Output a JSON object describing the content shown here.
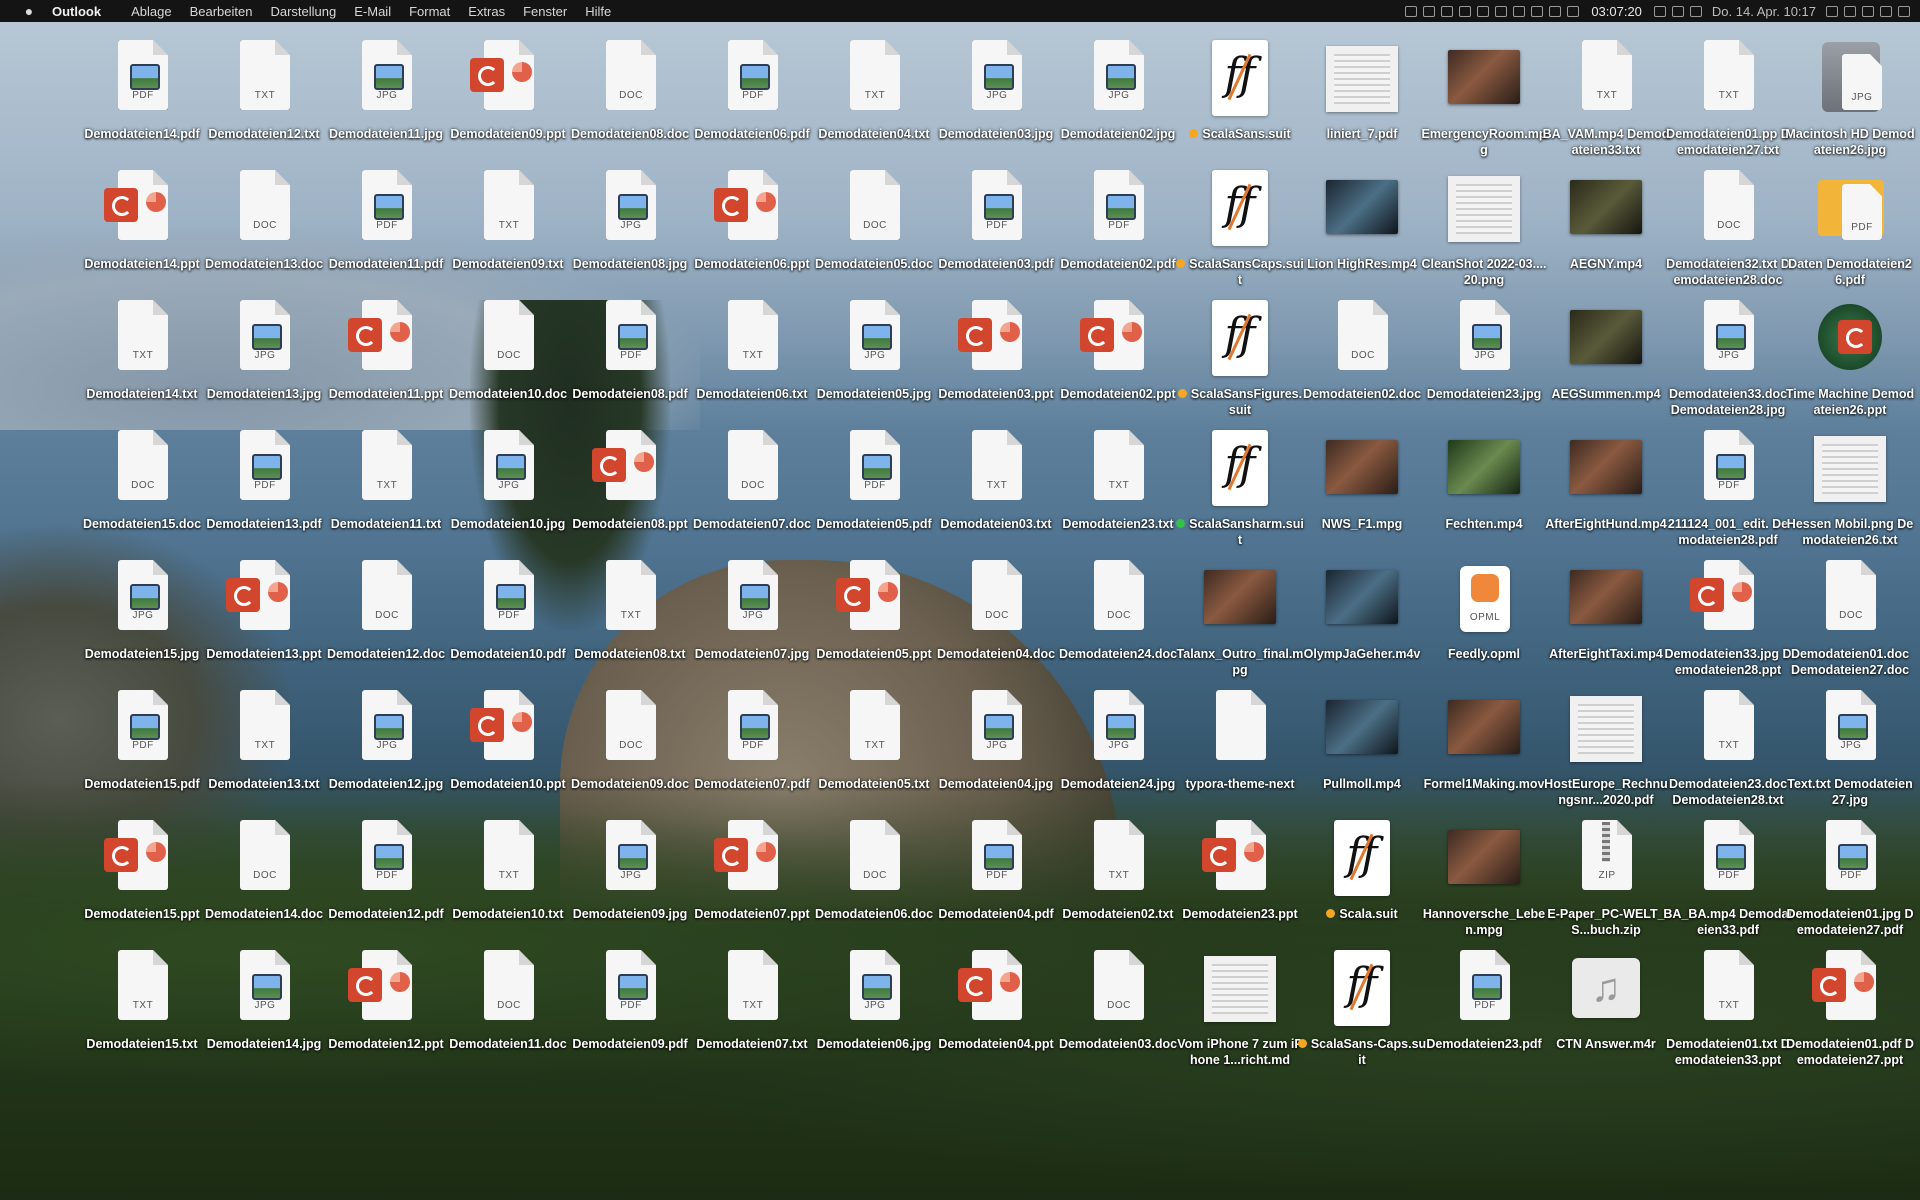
{
  "menubar": {
    "app": "Outlook",
    "menus": [
      "Ablage",
      "Bearbeiten",
      "Darstellung",
      "E-Mail",
      "Format",
      "Extras",
      "Fenster",
      "Hilfe"
    ],
    "timer": "03:07:20",
    "datetime": "Do. 14. Apr.  10:17"
  },
  "icons": [
    {
      "label": "Demodateien14.pdf",
      "kind": "pdf"
    },
    {
      "label": "Demodateien12.txt",
      "kind": "txt"
    },
    {
      "label": "Demodateien11.jpg",
      "kind": "jpg"
    },
    {
      "label": "Demodateien09.ppt",
      "kind": "ppt"
    },
    {
      "label": "Demodateien08.doc",
      "kind": "doc"
    },
    {
      "label": "Demodateien06.pdf",
      "kind": "pdf"
    },
    {
      "label": "Demodateien04.txt",
      "kind": "txt"
    },
    {
      "label": "Demodateien03.jpg",
      "kind": "jpg"
    },
    {
      "label": "Demodateien02.jpg",
      "kind": "jpg"
    },
    {
      "label": "ScalaSans.suit",
      "kind": "font",
      "tag": "orange"
    },
    {
      "label": "liniert_7.pdf",
      "kind": "img"
    },
    {
      "label": "EmergencyRoom.mpg",
      "kind": "video"
    },
    {
      "label": "BA_VAM.mp4 Demodateien33.txt",
      "kind": "txt"
    },
    {
      "label": "Demodateien01.pp Demodateien27.txt",
      "kind": "txt"
    },
    {
      "label": "Macintosh HD Demodateien26.jpg",
      "kind": "hd"
    },
    {
      "label": "Demodateien14.ppt",
      "kind": "ppt"
    },
    {
      "label": "Demodateien13.doc",
      "kind": "doc"
    },
    {
      "label": "Demodateien11.pdf",
      "kind": "pdf"
    },
    {
      "label": "Demodateien09.txt",
      "kind": "txt"
    },
    {
      "label": "Demodateien08.jpg",
      "kind": "jpg"
    },
    {
      "label": "Demodateien06.ppt",
      "kind": "ppt"
    },
    {
      "label": "Demodateien05.doc",
      "kind": "doc"
    },
    {
      "label": "Demodateien03.pdf",
      "kind": "pdf"
    },
    {
      "label": "Demodateien02.pdf",
      "kind": "pdf"
    },
    {
      "label": "ScalaSansCaps.suit",
      "kind": "font",
      "tag": "orange"
    },
    {
      "label": "Lion HighRes.mp4",
      "kind": "video",
      "variant": "v2"
    },
    {
      "label": "CleanShot 2022-03....20.png",
      "kind": "img"
    },
    {
      "label": "AEGNY.mp4",
      "kind": "video",
      "variant": "v3"
    },
    {
      "label": "Demodateien32.txt Demodateien28.doc",
      "kind": "doc"
    },
    {
      "label": "Daten Demodateien26.pdf",
      "kind": "folder"
    },
    {
      "label": "Demodateien14.txt",
      "kind": "txt"
    },
    {
      "label": "Demodateien13.jpg",
      "kind": "jpg"
    },
    {
      "label": "Demodateien11.ppt",
      "kind": "ppt"
    },
    {
      "label": "Demodateien10.doc",
      "kind": "doc"
    },
    {
      "label": "Demodateien08.pdf",
      "kind": "pdf"
    },
    {
      "label": "Demodateien06.txt",
      "kind": "txt"
    },
    {
      "label": "Demodateien05.jpg",
      "kind": "jpg"
    },
    {
      "label": "Demodateien03.ppt",
      "kind": "ppt"
    },
    {
      "label": "Demodateien02.ppt",
      "kind": "ppt"
    },
    {
      "label": "ScalaSansFigures.suit",
      "kind": "font",
      "tag": "orange"
    },
    {
      "label": "Demodateien02.doc",
      "kind": "doc"
    },
    {
      "label": "Demodateien23.jpg",
      "kind": "jpg"
    },
    {
      "label": "AEGSummen.mp4",
      "kind": "video",
      "variant": "v3"
    },
    {
      "label": "Demodateien33.doc Demodateien28.jpg",
      "kind": "jpg"
    },
    {
      "label": "Time Machine Demodateien26.ppt",
      "kind": "tm"
    },
    {
      "label": "Demodateien15.doc",
      "kind": "doc"
    },
    {
      "label": "Demodateien13.pdf",
      "kind": "pdf"
    },
    {
      "label": "Demodateien11.txt",
      "kind": "txt"
    },
    {
      "label": "Demodateien10.jpg",
      "kind": "jpg"
    },
    {
      "label": "Demodateien08.ppt",
      "kind": "ppt"
    },
    {
      "label": "Demodateien07.doc",
      "kind": "doc"
    },
    {
      "label": "Demodateien05.pdf",
      "kind": "pdf"
    },
    {
      "label": "Demodateien03.txt",
      "kind": "txt"
    },
    {
      "label": "Demodateien23.txt",
      "kind": "txt"
    },
    {
      "label": "ScalaSansharm.suit",
      "kind": "font",
      "tag": "green"
    },
    {
      "label": "NWS_F1.mpg",
      "kind": "video"
    },
    {
      "label": "Fechten.mp4",
      "kind": "video",
      "variant": "v4"
    },
    {
      "label": "AfterEightHund.mp4",
      "kind": "video"
    },
    {
      "label": "211124_001_edit. Demodateien28.pdf",
      "kind": "pdf"
    },
    {
      "label": "Hessen Mobil.png Demodateien26.txt",
      "kind": "img"
    },
    {
      "label": "Demodateien15.jpg",
      "kind": "jpg"
    },
    {
      "label": "Demodateien13.ppt",
      "kind": "ppt"
    },
    {
      "label": "Demodateien12.doc",
      "kind": "doc"
    },
    {
      "label": "Demodateien10.pdf",
      "kind": "pdf"
    },
    {
      "label": "Demodateien08.txt",
      "kind": "txt"
    },
    {
      "label": "Demodateien07.jpg",
      "kind": "jpg"
    },
    {
      "label": "Demodateien05.ppt",
      "kind": "ppt"
    },
    {
      "label": "Demodateien04.doc",
      "kind": "doc"
    },
    {
      "label": "Demodateien24.doc",
      "kind": "doc"
    },
    {
      "label": "Talanx_Outro_final.mpg",
      "kind": "video"
    },
    {
      "label": "OlympJaGeher.m4v",
      "kind": "video",
      "variant": "v2"
    },
    {
      "label": "Feedly.opml",
      "kind": "opml"
    },
    {
      "label": "AfterEightTaxi.mp4",
      "kind": "video"
    },
    {
      "label": "Demodateien33.jpg Demodateien28.ppt",
      "kind": "ppt"
    },
    {
      "label": "Demodateien01.doc Demodateien27.doc",
      "kind": "doc"
    },
    {
      "label": "Demodateien15.pdf",
      "kind": "pdf"
    },
    {
      "label": "Demodateien13.txt",
      "kind": "txt"
    },
    {
      "label": "Demodateien12.jpg",
      "kind": "jpg"
    },
    {
      "label": "Demodateien10.ppt",
      "kind": "ppt"
    },
    {
      "label": "Demodateien09.doc",
      "kind": "doc"
    },
    {
      "label": "Demodateien07.pdf",
      "kind": "pdf"
    },
    {
      "label": "Demodateien05.txt",
      "kind": "txt"
    },
    {
      "label": "Demodateien04.jpg",
      "kind": "jpg"
    },
    {
      "label": "Demodateien24.jpg",
      "kind": "jpg"
    },
    {
      "label": "typora-theme-next",
      "kind": "blank"
    },
    {
      "label": "Pullmoll.mp4",
      "kind": "video",
      "variant": "v2"
    },
    {
      "label": "Formel1Making.mov",
      "kind": "video"
    },
    {
      "label": "HostEurope_Rechnungsnr...2020.pdf",
      "kind": "img"
    },
    {
      "label": "Demodateien23.doc Demodateien28.txt",
      "kind": "txt"
    },
    {
      "label": "Text.txt Demodateien27.jpg",
      "kind": "jpg"
    },
    {
      "label": "Demodateien15.ppt",
      "kind": "ppt"
    },
    {
      "label": "Demodateien14.doc",
      "kind": "doc"
    },
    {
      "label": "Demodateien12.pdf",
      "kind": "pdf"
    },
    {
      "label": "Demodateien10.txt",
      "kind": "txt"
    },
    {
      "label": "Demodateien09.jpg",
      "kind": "jpg"
    },
    {
      "label": "Demodateien07.ppt",
      "kind": "ppt"
    },
    {
      "label": "Demodateien06.doc",
      "kind": "doc"
    },
    {
      "label": "Demodateien04.pdf",
      "kind": "pdf"
    },
    {
      "label": "Demodateien02.txt",
      "kind": "txt"
    },
    {
      "label": "Demodateien23.ppt",
      "kind": "ppt"
    },
    {
      "label": "Scala.suit",
      "kind": "font",
      "tag": "orange"
    },
    {
      "label": "Hannoversche_Leben.mpg",
      "kind": "video"
    },
    {
      "label": "E-Paper_PC-WELT_S...buch.zip",
      "kind": "zip"
    },
    {
      "label": "BA_BA.mp4 Demodateien33.pdf",
      "kind": "pdf"
    },
    {
      "label": "Demodateien01.jpg Demodateien27.pdf",
      "kind": "pdf"
    },
    {
      "label": "Demodateien15.txt",
      "kind": "txt"
    },
    {
      "label": "Demodateien14.jpg",
      "kind": "jpg"
    },
    {
      "label": "Demodateien12.ppt",
      "kind": "ppt"
    },
    {
      "label": "Demodateien11.doc",
      "kind": "doc"
    },
    {
      "label": "Demodateien09.pdf",
      "kind": "pdf"
    },
    {
      "label": "Demodateien07.txt",
      "kind": "txt"
    },
    {
      "label": "Demodateien06.jpg",
      "kind": "jpg"
    },
    {
      "label": "Demodateien04.ppt",
      "kind": "ppt"
    },
    {
      "label": "Demodateien03.doc",
      "kind": "doc"
    },
    {
      "label": "Vom iPhone 7 zum iPhone 1...richt.md",
      "kind": "img"
    },
    {
      "label": "ScalaSans-Caps.suit",
      "kind": "font",
      "tag": "orange"
    },
    {
      "label": "Demodateien23.pdf",
      "kind": "pdf"
    },
    {
      "label": "CTN Answer.m4r",
      "kind": "music"
    },
    {
      "label": "Demodateien01.txt Demodateien33.ppt",
      "kind": "txt"
    },
    {
      "label": "Demodateien01.pdf Demodateien27.ppt",
      "kind": "ppt"
    }
  ]
}
